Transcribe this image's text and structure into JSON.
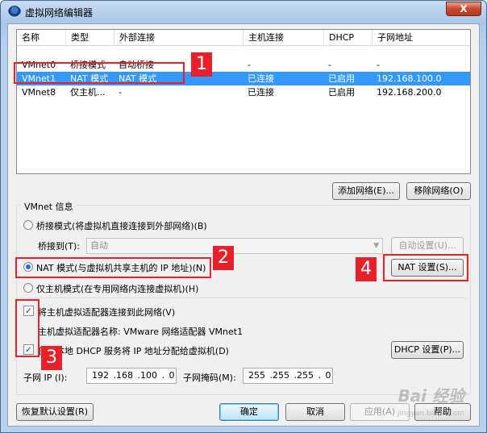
{
  "window": {
    "title": "虚拟网络编辑器",
    "close_glyph": "X"
  },
  "table": {
    "columns": [
      "名称",
      "类型",
      "外部连接",
      "主机连接",
      "DHCP",
      "子网地址"
    ],
    "rows": [
      {
        "name": "VMnet0",
        "type": "桥接模式",
        "external": "自动桥接",
        "host": "-",
        "dhcp": "-",
        "subnet": "-"
      },
      {
        "name": "VMnet1",
        "type": "NAT 模式",
        "external": "NAT 模式",
        "host": "已连接",
        "dhcp": "已启用",
        "subnet": "192.168.100.0"
      },
      {
        "name": "VMnet8",
        "type": "仅主机...",
        "external": "-",
        "host": "已连接",
        "dhcp": "已启用",
        "subnet": "192.168.200.0"
      }
    ]
  },
  "buttons": {
    "add_network": "添加网络(E)...",
    "remove_network": "移除网络(O)",
    "auto_settings": "自动设置(U)...",
    "nat_settings": "NAT 设置(S)...",
    "dhcp_settings": "DHCP 设置(P)...",
    "restore_defaults": "恢复默认设置(R)",
    "ok": "确定",
    "cancel": "取消",
    "apply": "应用(A)",
    "help": "帮助"
  },
  "vmnet_info": {
    "title": "VMnet 信息",
    "bridged_label": "桥接模式(将虚拟机直接连接到外部网络)(B)",
    "bridged_to_label": "桥接到(T):",
    "bridged_to_value": "自动",
    "nat_label": "NAT 模式(与虚拟机共享主机的 IP 地址)(N)",
    "hostonly_label": "仅主机模式(在专用网络内连接虚拟机)(H)",
    "connect_adapter_label": "将主机虚拟适配器连接到此网络(V)",
    "adapter_name_label": "主机虚拟适配器名称: VMware 网络适配器 VMnet1",
    "use_dhcp_label": "使用本地 DHCP 服务将 IP 地址分配给虚拟机(D)",
    "subnet_ip_label": "子网 IP (I):",
    "subnet_ip_value": "192 .168 .100 . 0",
    "subnet_mask_label": "子网掩码(M):",
    "subnet_mask_value": "255 .255 .255 . 0",
    "selected_mode": "nat",
    "connect_adapter_checked": true,
    "use_dhcp_checked": true
  },
  "annotations": [
    "1",
    "2",
    "3",
    "4"
  ],
  "watermark": {
    "text": "Bai 经验",
    "sub": "jingyan.baidu.com"
  },
  "colors": {
    "selection": "#3399ff",
    "annotation": "#e8202a"
  }
}
